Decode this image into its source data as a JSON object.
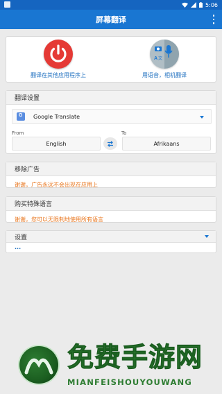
{
  "status_bar": {
    "time": "5:06"
  },
  "app_bar": {
    "title": "屏幕翻译"
  },
  "top_actions": {
    "translate_in_apps": "翻译在其他应用程序上",
    "translate_voice_camera": "用语音，相机翻译"
  },
  "settings": {
    "header": "翻译设置",
    "engine": "Google Translate",
    "from_label": "From",
    "to_label": "To",
    "from_lang": "English",
    "to_lang": "Afrikaans"
  },
  "remove_ads": {
    "header": "移除广告",
    "message": "谢谢，广告永远不会出现在应用上"
  },
  "special_languages": {
    "header": "购买特殊语言",
    "message": "谢谢，您可以无限制地使用所有语言"
  },
  "preferences": {
    "header": "设置",
    "placeholder": "..."
  },
  "watermark": {
    "title": "免费手游网",
    "subtitle": "MIANFEISHOUYOUWANG"
  }
}
